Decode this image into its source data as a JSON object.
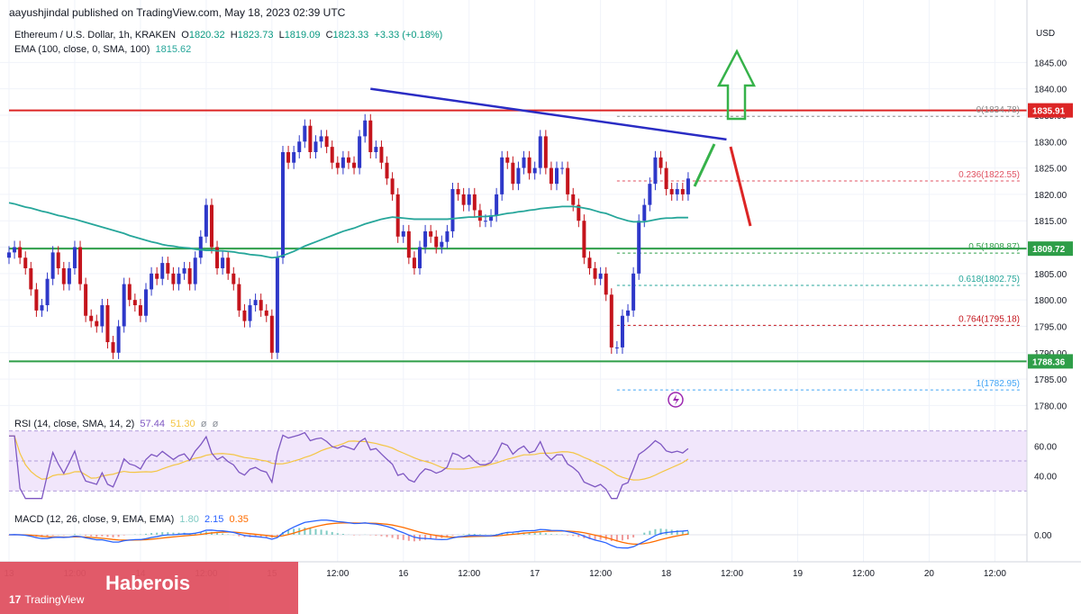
{
  "publisher": "aayushjindal published on TradingView.com, May 18, 2023 02:39 UTC",
  "legend": {
    "symbol": "Ethereum / U.S. Dollar, 1h, KRAKEN",
    "o_label": "O",
    "o": "1820.32",
    "h_label": "H",
    "h": "1823.73",
    "l_label": "L",
    "l": "1819.09",
    "c_label": "C",
    "c": "1823.33",
    "change": "+3.33 (+0.18%)",
    "ema_label": "EMA (100, close, 0, SMA, 100)",
    "ema_value": "1815.62",
    "rsi_label": "RSI (14, close, SMA, 14, 2)",
    "rsi_value": "57.44",
    "rsi_sma": "51.30",
    "rsi_extra1": "ø",
    "rsi_extra2": "ø",
    "macd_label": "MACD (12, 26, close, 9, EMA, EMA)",
    "macd_hist": "1.80",
    "macd_line": "2.15",
    "macd_signal": "0.35"
  },
  "watermark": {
    "text": "Haberois",
    "logo": "TradingView",
    "logo_mark": "17"
  },
  "colors": {
    "up": "#2e38c9",
    "down": "#c4141c",
    "ema": "#26a69a",
    "trendline": "#2a2cc4",
    "resistance": "#dc2525",
    "support": "#2e9e48",
    "fib": "#a5acb3",
    "arrow_up": "#36b24a",
    "arrow_down": "#dc2525",
    "rsi": "#7e57c2",
    "rsi_band": "#f1e6fb",
    "macd": "#2962ff",
    "signal": "#ff6d00"
  },
  "chart_data": {
    "type": "candlestick",
    "currency": "USD",
    "y_range": [
      1777,
      1850
    ],
    "y_ticks": [
      1780,
      1785,
      1790,
      1795,
      1800,
      1805,
      1810,
      1815,
      1820,
      1825,
      1830,
      1835,
      1840,
      1845
    ],
    "y_tick_labels": [
      "1780.00",
      "1785.00",
      "1790.00",
      "1795.00",
      "1800.00",
      "1805.00",
      "1810.00",
      "1815.00",
      "1820.00",
      "1825.00",
      "1830.00",
      "1835.00",
      "1840.00",
      "1845.00"
    ],
    "x_range_hours": [
      0,
      172
    ],
    "x_ticks": [
      {
        "t": 0,
        "label": "13"
      },
      {
        "t": 12,
        "label": "12:00"
      },
      {
        "t": 24,
        "label": "14"
      },
      {
        "t": 36,
        "label": "12:00"
      },
      {
        "t": 48,
        "label": "15"
      },
      {
        "t": 60,
        "label": "12:00"
      },
      {
        "t": 72,
        "label": "16"
      },
      {
        "t": 84,
        "label": "12:00"
      },
      {
        "t": 96,
        "label": "17"
      },
      {
        "t": 108,
        "label": "12:00"
      },
      {
        "t": 120,
        "label": "18"
      },
      {
        "t": 132,
        "label": "12:00"
      },
      {
        "t": 144,
        "label": "19"
      },
      {
        "t": 156,
        "label": "12:00"
      },
      {
        "t": 168,
        "label": "20"
      },
      {
        "t": 180,
        "label": "12:00"
      }
    ],
    "closes": [
      1809,
      1810,
      1808,
      1806,
      1802,
      1798,
      1799,
      1804,
      1809,
      1806,
      1803,
      1806,
      1810,
      1803,
      1797,
      1796,
      1795,
      1799,
      1792,
      1790,
      1795,
      1803,
      1800,
      1799,
      1797,
      1802,
      1805,
      1804,
      1807,
      1805,
      1803,
      1805,
      1806,
      1803,
      1808,
      1812,
      1818,
      1810,
      1806,
      1808,
      1805,
      1803,
      1798,
      1796,
      1799,
      1800,
      1798,
      1797,
      1790,
      1808,
      1828,
      1826,
      1828,
      1830,
      1833,
      1828,
      1830,
      1831,
      1829,
      1826,
      1825,
      1827,
      1826,
      1825,
      1831,
      1834,
      1828,
      1829,
      1826,
      1823,
      1820,
      1812,
      1813,
      1808,
      1806,
      1810,
      1813,
      1812,
      1810,
      1811,
      1813,
      1821,
      1820,
      1818,
      1820,
      1817,
      1815,
      1815,
      1816,
      1820,
      1827,
      1826,
      1822,
      1825,
      1827,
      1824,
      1825,
      1831,
      1825,
      1822,
      1825,
      1825,
      1820,
      1818,
      1815,
      1808,
      1806,
      1804,
      1805,
      1801,
      1791,
      1791,
      1797,
      1798,
      1805,
      1815,
      1818,
      1822,
      1827,
      1825,
      1821,
      1820,
      1821,
      1820,
      1823
    ],
    "ema": [
      1818.4,
      1818.2,
      1817.9,
      1817.6,
      1817.4,
      1817.1,
      1816.8,
      1816.6,
      1816.3,
      1816.0,
      1815.8,
      1815.5,
      1815.3,
      1815.0,
      1814.7,
      1814.4,
      1814.1,
      1813.8,
      1813.5,
      1813.2,
      1812.9,
      1812.6,
      1812.2,
      1811.9,
      1811.6,
      1811.3,
      1811.0,
      1810.8,
      1810.5,
      1810.3,
      1810.2,
      1810.0,
      1809.9,
      1809.8,
      1809.6,
      1809.5,
      1809.4,
      1809.4,
      1809.3,
      1809.3,
      1809.2,
      1809.1,
      1808.9,
      1808.8,
      1808.6,
      1808.5,
      1808.4,
      1808.2,
      1808.0,
      1808.1,
      1808.4,
      1808.8,
      1809.2,
      1809.7,
      1810.2,
      1810.6,
      1811.0,
      1811.4,
      1811.8,
      1812.2,
      1812.6,
      1813.0,
      1813.3,
      1813.6,
      1814.0,
      1814.4,
      1814.7,
      1815.0,
      1815.3,
      1815.5,
      1815.7,
      1815.6,
      1815.5,
      1815.4,
      1815.3,
      1815.3,
      1815.3,
      1815.3,
      1815.3,
      1815.3,
      1815.3,
      1815.4,
      1815.5,
      1815.6,
      1815.7,
      1815.7,
      1815.8,
      1815.8,
      1815.9,
      1816.0,
      1816.2,
      1816.4,
      1816.5,
      1816.7,
      1816.8,
      1817.0,
      1817.1,
      1817.3,
      1817.4,
      1817.5,
      1817.6,
      1817.7,
      1817.7,
      1817.7,
      1817.6,
      1817.4,
      1817.2,
      1816.9,
      1816.6,
      1816.4,
      1816.0,
      1815.6,
      1815.3,
      1815.0,
      1814.8,
      1814.8,
      1814.8,
      1815.0,
      1815.2,
      1815.4,
      1815.5,
      1815.5,
      1815.6,
      1815.6,
      1815.6
    ],
    "annotations": {
      "resistance": 1835.91,
      "resistance_label": "1835.91",
      "support_mid": 1809.72,
      "support_mid_label": "1809.72",
      "support_low": 1788.36,
      "support_low_label": "1788.36",
      "trendline": [
        {
          "t": 66,
          "v": 1840
        },
        {
          "t": 131,
          "v": 1830.4
        }
      ],
      "fib": [
        {
          "level": "0",
          "value": 1834.78,
          "label": "0(1834.78)"
        },
        {
          "level": "0.236",
          "value": 1822.55,
          "label": "0.236(1822.55)"
        },
        {
          "level": "0.5",
          "value": 1808.87,
          "label": "0.5(1808.87)"
        },
        {
          "level": "0.618",
          "value": 1802.75,
          "label": "0.618(1802.75)"
        },
        {
          "level": "0.764",
          "value": 1795.18,
          "label": "0.764(1795.18)"
        },
        {
          "level": "1",
          "value": 1782.95,
          "label": "1(1782.95)"
        }
      ]
    },
    "rsi": {
      "y_range": [
        20,
        80
      ],
      "y_ticks": [
        40,
        60
      ],
      "y_tick_labels": [
        "40.00",
        "60.00"
      ],
      "band": [
        30,
        70
      ]
    },
    "macd": {
      "y_ticks": [
        0
      ],
      "y_tick_labels": [
        "0.00"
      ]
    }
  }
}
